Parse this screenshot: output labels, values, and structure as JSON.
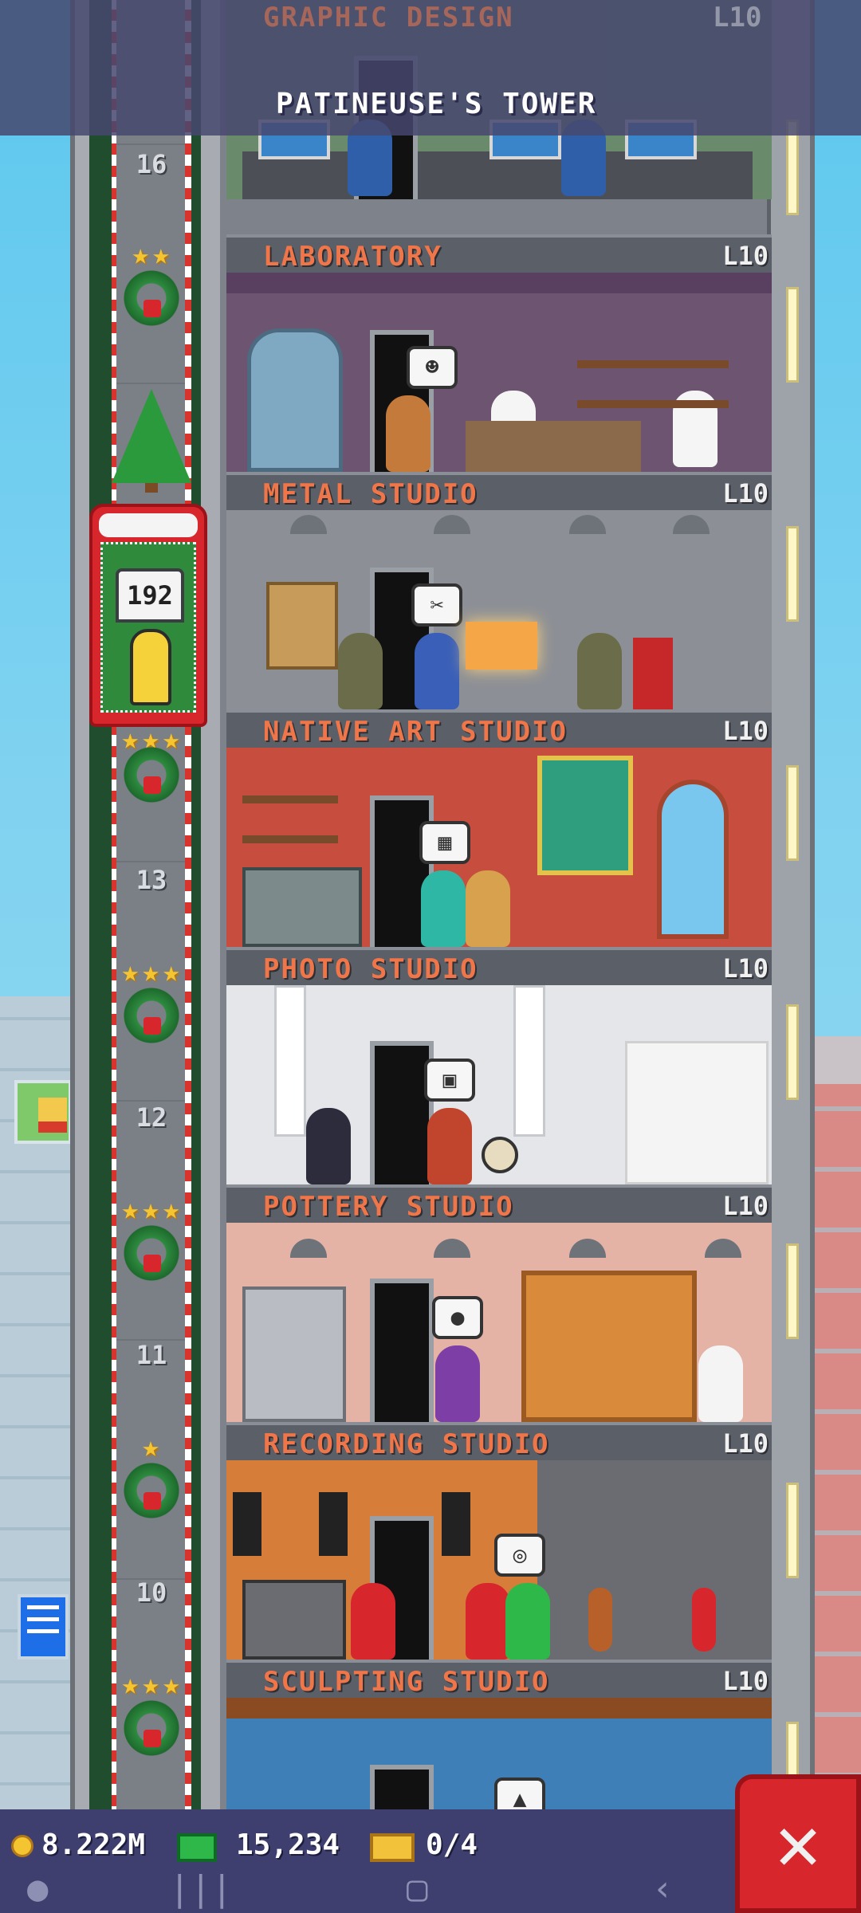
{
  "top": {
    "partial_floor_name": "GRAPHIC DESIGN",
    "partial_floor_level": "L10",
    "tower_title": "PATINEUSE'S TOWER"
  },
  "elevator": {
    "sign_value": "192",
    "shaft_floor_numbers": [
      "16",
      "13",
      "12",
      "11",
      "10"
    ]
  },
  "floors": [
    {
      "name": "LABORATORY",
      "level": "L10"
    },
    {
      "name": "METAL STUDIO",
      "level": "L10"
    },
    {
      "name": "NATIVE ART STUDIO",
      "level": "L10"
    },
    {
      "name": "PHOTO STUDIO",
      "level": "L10"
    },
    {
      "name": "POTTERY STUDIO",
      "level": "L10"
    },
    {
      "name": "RECORDING STUDIO",
      "level": "L10"
    },
    {
      "name": "SCULPTING STUDIO",
      "level": "L10"
    }
  ],
  "status": {
    "coins": "8.222M",
    "bux": "15,234",
    "tickets": "0/4"
  },
  "icons": {
    "coin": "coin-icon",
    "bux": "bux-icon",
    "ticket": "ticket-icon",
    "close": "close-icon",
    "nav_game": "gamepad-icon",
    "nav_recents": "recents-icon",
    "nav_home": "home-icon",
    "nav_back": "back-icon"
  },
  "colors": {
    "floor_label": "#f0764a",
    "elevator": "#d8262d",
    "status_bar": "#3e3f6f"
  }
}
